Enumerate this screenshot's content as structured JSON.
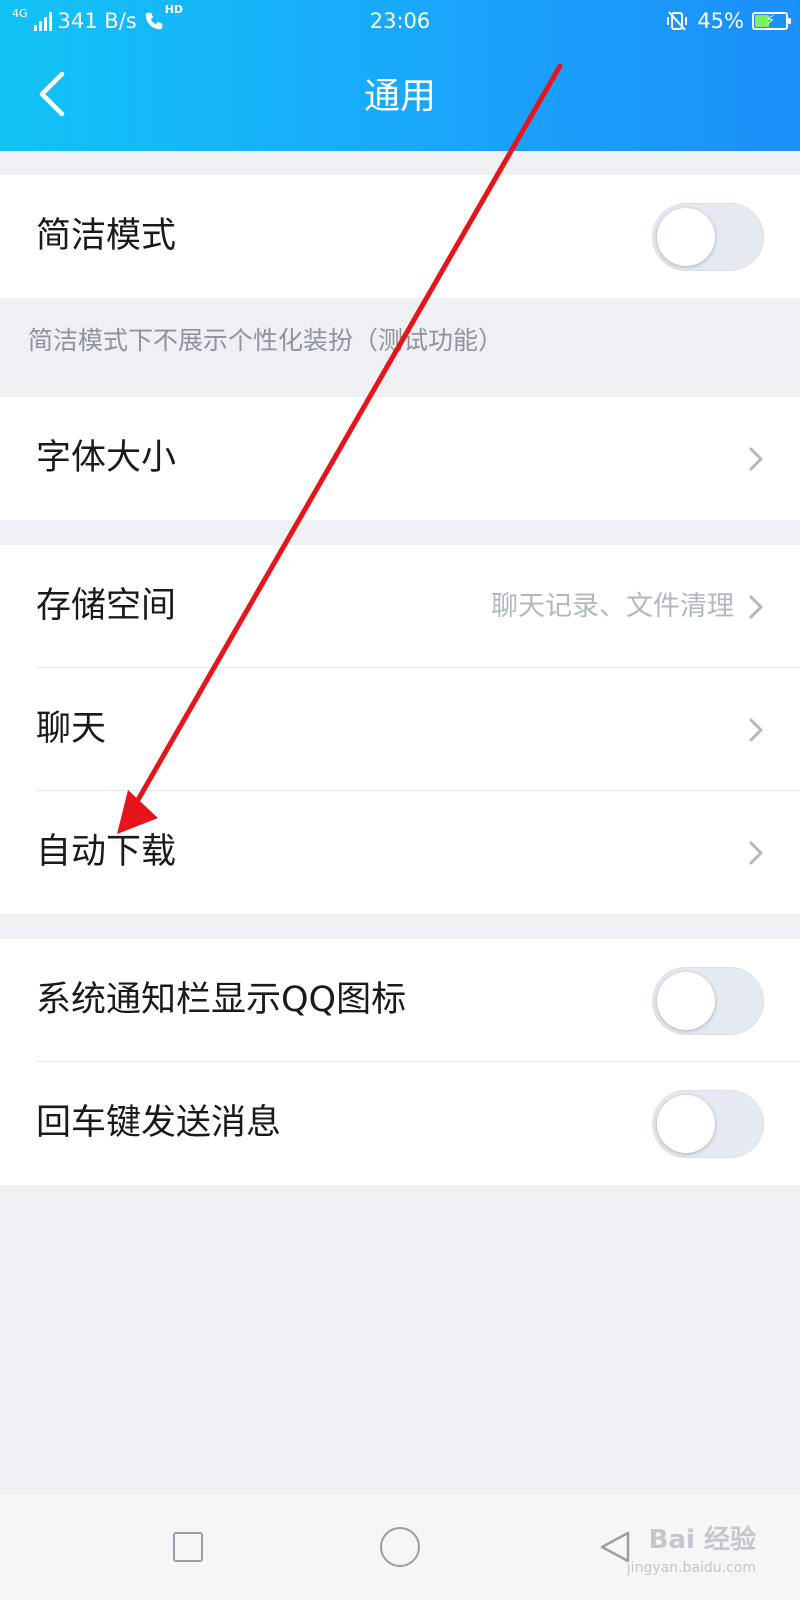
{
  "status_bar": {
    "network": "4G",
    "speed": "341 B/s",
    "hd": "HD",
    "time": "23:06",
    "battery": "45%",
    "battery_level": 0.45
  },
  "header": {
    "title": "通用"
  },
  "settings": {
    "concise_mode": {
      "label": "简洁模式",
      "enabled": false
    },
    "concise_hint": "简洁模式下不展示个性化装扮（测试功能）",
    "font_size": {
      "label": "字体大小"
    },
    "storage": {
      "label": "存储空间",
      "detail": "聊天记录、文件清理"
    },
    "chat": {
      "label": "聊天"
    },
    "auto_download": {
      "label": "自动下载"
    },
    "notification_icon": {
      "label": "系统通知栏显示QQ图标",
      "enabled": false
    },
    "enter_to_send": {
      "label": "回车键发送消息",
      "enabled": false
    }
  },
  "watermark": {
    "brand": "Bai 经验",
    "url": "jingyan.baidu.com"
  },
  "colors": {
    "header_start": "#12c3f6",
    "header_end": "#1b8ff9",
    "annotation_arrow": "#e8141b",
    "toggle_off": "#e7e9f2"
  }
}
